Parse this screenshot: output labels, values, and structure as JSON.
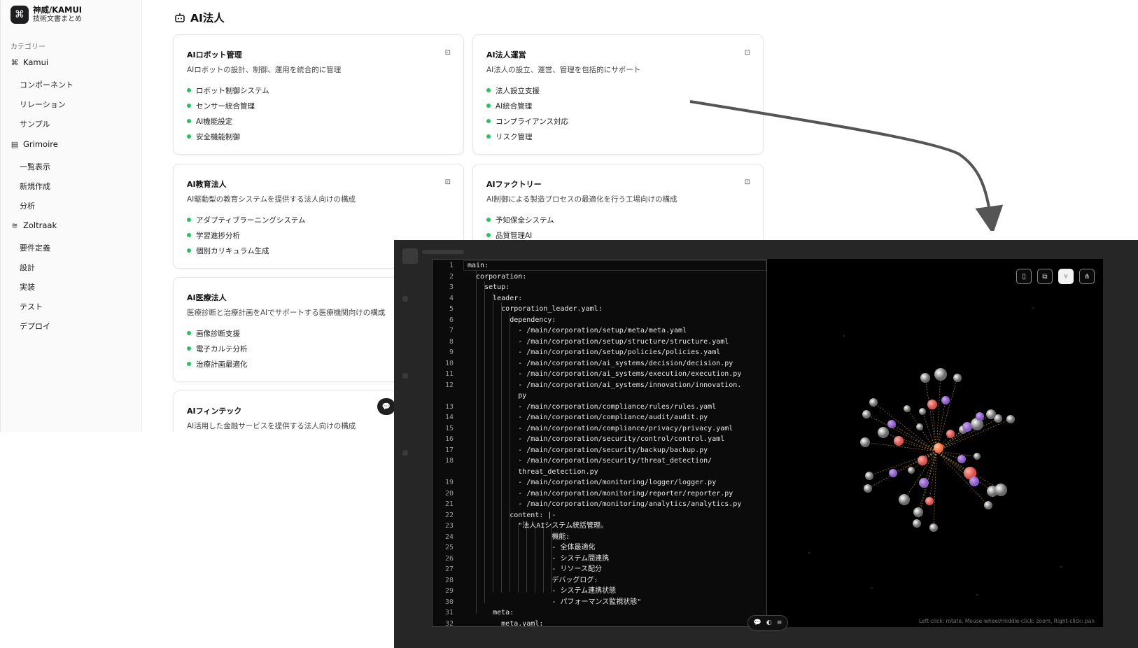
{
  "brand": {
    "logo": "⌘",
    "title": "神威/KAMUI",
    "subtitle": "技術文書まとめ"
  },
  "sidebar": {
    "category_label": "カテゴリー",
    "groups": [
      {
        "icon": "⌘",
        "icon_name": "command-icon",
        "label": "Kamui",
        "items": [
          "コンポーネント",
          "リレーション",
          "サンプル"
        ]
      },
      {
        "icon": "▤",
        "icon_name": "database-icon",
        "label": "Grimoire",
        "items": [
          "一覧表示",
          "新規作成",
          "分析"
        ]
      },
      {
        "icon": "≋",
        "icon_name": "waveform-icon",
        "label": "Zoltraak",
        "items": [
          "要件定義",
          "設計",
          "実装",
          "テスト",
          "デプロイ"
        ]
      }
    ]
  },
  "main": {
    "title": "AI法人",
    "cards": [
      {
        "title": "AIロボット管理",
        "desc": "AIロボットの設計、制御、運用を統合的に管理",
        "items": [
          "ロボット制御システム",
          "センサー統合管理",
          "AI機能設定",
          "安全機能制御"
        ]
      },
      {
        "title": "AI法人運営",
        "desc": "AI法人の設立、運営、管理を包括的にサポート",
        "items": [
          "法人設立支援",
          "AI統合管理",
          "コンプライアンス対応",
          "リスク管理"
        ]
      },
      {
        "title": "AI教育法人",
        "desc": "AI駆動型の教育システムを提供する法人向けの構成",
        "items": [
          "アダプティブラーニングシステム",
          "学習進捗分析",
          "個別カリキュラム生成"
        ]
      },
      {
        "title": "AIファクトリー",
        "desc": "AI制御による製造プロセスの最適化を行う工場向けの構成",
        "items": [
          "予知保全システム",
          "品質管理AI"
        ]
      },
      {
        "title": "AI医療法人",
        "desc": "医療診断と治療計画をAIでサポートする医療機関向けの構成",
        "items": [
          "画像診断支援",
          "電子カルテ分析",
          "治療計画最適化"
        ]
      },
      {
        "title": "AIフィンテック",
        "desc": "AI活用した金融サービスを提供する法人向けの構成",
        "items": []
      }
    ]
  },
  "editor": {
    "lines": [
      {
        "n": "1",
        "t": "main:"
      },
      {
        "n": "2",
        "t": "  corporation:"
      },
      {
        "n": "3",
        "t": "    setup:"
      },
      {
        "n": "4",
        "t": "      leader:"
      },
      {
        "n": "5",
        "t": "        corporation_leader.yaml:"
      },
      {
        "n": "6",
        "t": "          dependency:"
      },
      {
        "n": "7",
        "t": "            - /main/corporation/setup/meta/meta.yaml"
      },
      {
        "n": "8",
        "t": "            - /main/corporation/setup/structure/structure.yaml"
      },
      {
        "n": "9",
        "t": "            - /main/corporation/setup/policies/policies.yaml"
      },
      {
        "n": "10",
        "t": "            - /main/corporation/ai_systems/decision/decision.py"
      },
      {
        "n": "11",
        "t": "            - /main/corporation/ai_systems/execution/execution.py"
      },
      {
        "n": "12",
        "t": "            - /main/corporation/ai_systems/innovation/innovation."
      },
      {
        "n": "",
        "t": "            py"
      },
      {
        "n": "13",
        "t": "            - /main/corporation/compliance/rules/rules.yaml"
      },
      {
        "n": "14",
        "t": "            - /main/corporation/compliance/audit/audit.py"
      },
      {
        "n": "15",
        "t": "            - /main/corporation/compliance/privacy/privacy.yaml"
      },
      {
        "n": "16",
        "t": "            - /main/corporation/security/control/control.yaml"
      },
      {
        "n": "17",
        "t": "            - /main/corporation/security/backup/backup.py"
      },
      {
        "n": "18",
        "t": "            - /main/corporation/security/threat_detection/"
      },
      {
        "n": "",
        "t": "            threat_detection.py"
      },
      {
        "n": "19",
        "t": "            - /main/corporation/monitoring/logger/logger.py"
      },
      {
        "n": "20",
        "t": "            - /main/corporation/monitoring/reporter/reporter.py"
      },
      {
        "n": "21",
        "t": "            - /main/corporation/monitoring/analytics/analytics.py"
      },
      {
        "n": "22",
        "t": "          content: |-"
      },
      {
        "n": "23",
        "t": "            \"法人AIシステム統括管理。"
      },
      {
        "n": "24",
        "t": "                    機能:"
      },
      {
        "n": "25",
        "t": "                    - 全体最適化"
      },
      {
        "n": "26",
        "t": "                    - システム間連携"
      },
      {
        "n": "27",
        "t": "                    - リソース配分"
      },
      {
        "n": "28",
        "t": "                    デバッグログ:"
      },
      {
        "n": "29",
        "t": "                    - システム連携状態"
      },
      {
        "n": "30",
        "t": "                    - パフォーマンス監視状態\""
      },
      {
        "n": "31",
        "t": "      meta:"
      },
      {
        "n": "32",
        "t": "        meta.yaml:"
      }
    ]
  },
  "viewer": {
    "tools": [
      {
        "icon": "▯",
        "name": "document-view-icon"
      },
      {
        "icon": "⧉",
        "name": "folder-graph-icon"
      },
      {
        "icon": "⑂",
        "name": "git-branch-icon"
      },
      {
        "icon": "⋔",
        "name": "network-icon"
      }
    ],
    "active_tool": 2,
    "hint": "Left-click: rotate, Mouse-wheel/middle-click: zoom, Right-click: pan"
  },
  "colors": {
    "accent_green": "#22c55e",
    "node_white": "#e8e8e8",
    "node_purple": "#8b5cc4",
    "node_red": "#d9534f",
    "node_center": "#ff6a3d"
  },
  "bottom_pill": {
    "icons": [
      "💬",
      "◐",
      "≡"
    ]
  }
}
